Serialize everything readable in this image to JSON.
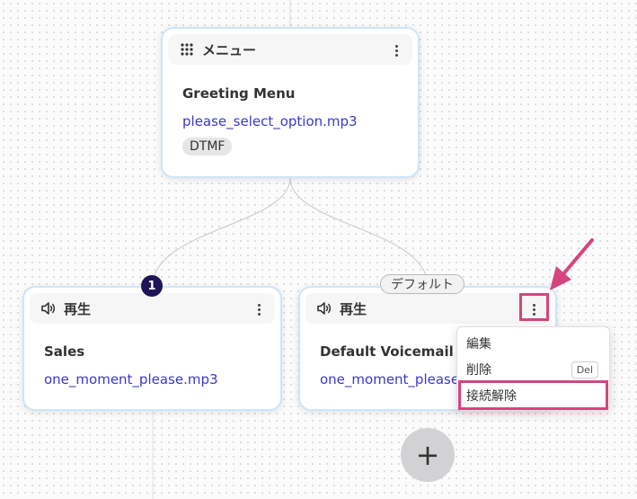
{
  "menu_node": {
    "header_title": "メニュー",
    "header_icon": "grid-icon",
    "name": "Greeting Menu",
    "file": "please_select_option.mp3",
    "chip": "DTMF"
  },
  "sales_node": {
    "header_title": "再生",
    "header_icon": "speaker-icon",
    "name": "Sales",
    "file": "one_moment_please.mp3",
    "badge": "1"
  },
  "voicemail_node": {
    "header_title": "再生",
    "header_icon": "speaker-icon",
    "name": "Default Voicemail",
    "file": "one_moment_please.mp3",
    "tag": "デフォルト"
  },
  "context_menu": {
    "items": [
      {
        "label": "編集"
      },
      {
        "label": "削除",
        "shortcut": "Del"
      },
      {
        "label": "接続解除"
      }
    ]
  },
  "add_button": {
    "label": "+"
  },
  "colors": {
    "accent_link": "#3b39c6",
    "highlight": "#d6457d",
    "node_border": "#cfe5f7",
    "badge": "#1f1457"
  }
}
